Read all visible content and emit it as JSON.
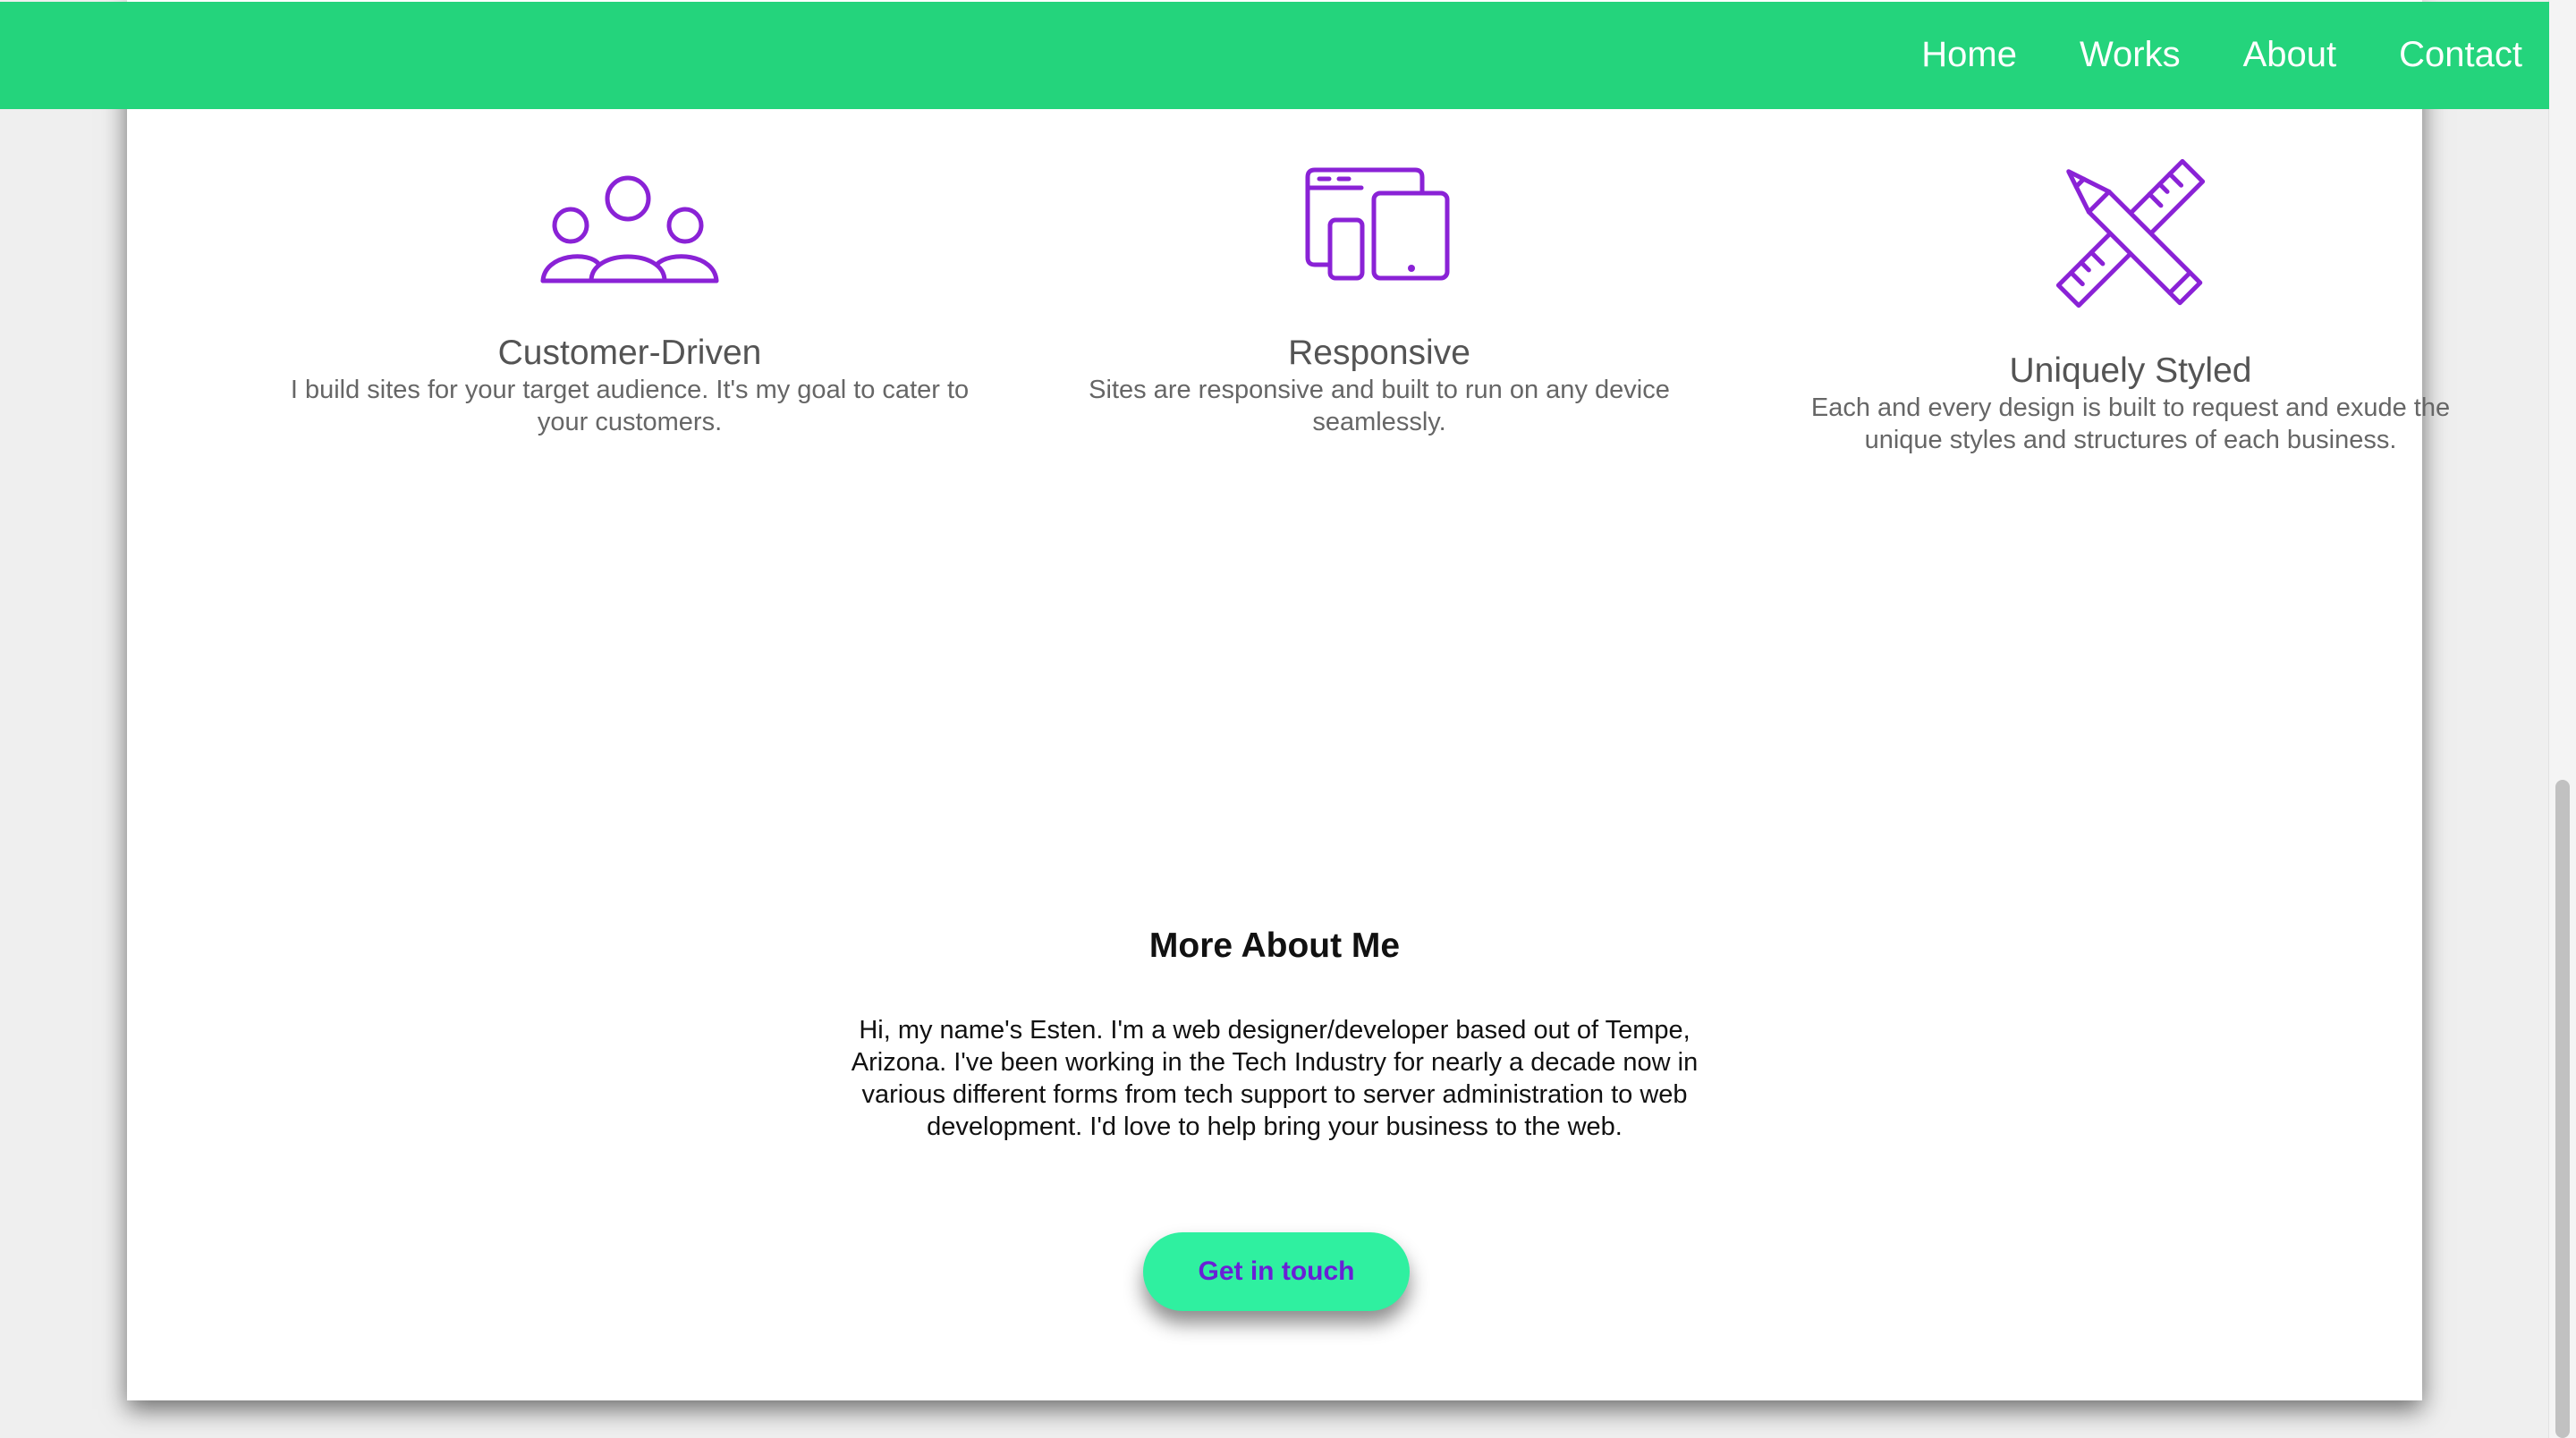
{
  "nav": {
    "links": [
      "Home",
      "Works",
      "About",
      "Contact"
    ]
  },
  "features": [
    {
      "icon": "customers-icon",
      "title": "Customer-Driven",
      "text": "I build sites for your target audience. It's my goal to cater to your customers."
    },
    {
      "icon": "devices-icon",
      "title": "Responsive",
      "text": "Sites are responsive and built to run on any device seamlessly."
    },
    {
      "icon": "pencil-ruler-icon",
      "title": "Uniquely Styled",
      "text": "Each and every design is built to request and exude the unique styles and structures of each business."
    }
  ],
  "about": {
    "heading": "More About Me",
    "text": "Hi, my name's Esten. I'm a web designer/developer based out of Tempe, Arizona. I've been working in the Tech Industry for nearly a decade now in various different forms from tech support to server administration to web development. I'd love to help bring your business to the web.",
    "cta_label": "Get in touch"
  },
  "colors": {
    "nav_bg": "#24d47c",
    "icon_purple": "#8a22d6",
    "cta_bg": "#2ff0a0",
    "cta_text": "#6a1fd6"
  }
}
